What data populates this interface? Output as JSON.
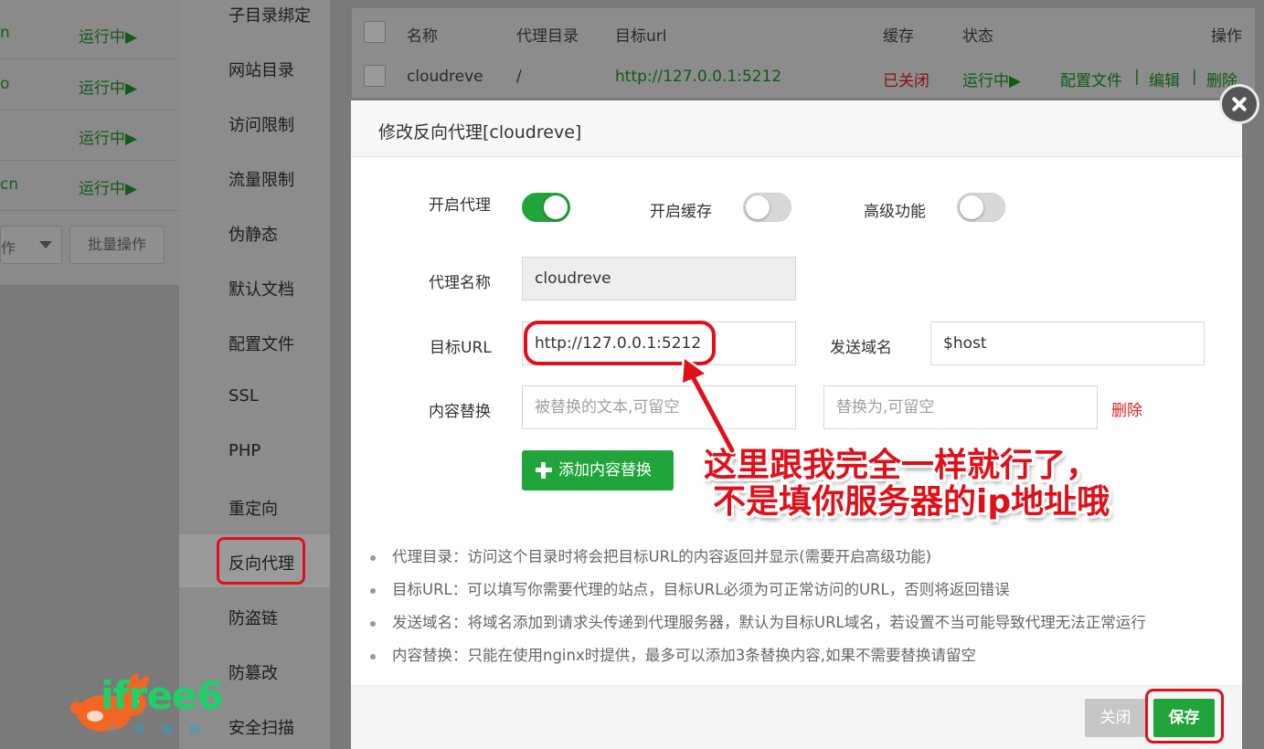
{
  "background_list": {
    "rows": [
      {
        "fragment": "n",
        "status": "运行中▶"
      },
      {
        "fragment": "o",
        "status": "运行中▶"
      },
      {
        "fragment": "",
        "status": "运行中▶"
      },
      {
        "fragment": "cn",
        "status": "运行中▶"
      }
    ],
    "select_label": "作",
    "batch_button": "批量操作"
  },
  "menu": {
    "items": [
      "子目录绑定",
      "网站目录",
      "访问限制",
      "流量限制",
      "伪静态",
      "默认文档",
      "配置文件",
      "SSL",
      "PHP",
      "重定向",
      "反向代理",
      "防盗链",
      "防篡改",
      "安全扫描"
    ],
    "active": "反向代理"
  },
  "proxy_table": {
    "headers": {
      "name": "名称",
      "dir": "代理目录",
      "url": "目标url",
      "cache": "缓存",
      "status": "状态",
      "ops": "操作"
    },
    "row": {
      "name": "cloudreve",
      "dir": "/",
      "url": "http://127.0.0.1:5212",
      "cache": "已关闭",
      "status": "运行中▶",
      "op_config": "配置文件",
      "sep1": "|",
      "op_edit": "编辑",
      "sep2": "|",
      "op_delete": "删除"
    }
  },
  "dialog": {
    "title": "修改反向代理[cloudreve]",
    "switches": {
      "proxy_label": "开启代理",
      "proxy_on": true,
      "cache_label": "开启缓存",
      "cache_on": false,
      "advanced_label": "高级功能",
      "advanced_on": false
    },
    "proxy_name_label": "代理名称",
    "proxy_name_value": "cloudreve",
    "target_url_label": "目标URL",
    "target_url_value": "http://127.0.0.1:5212",
    "send_domain_label": "发送域名",
    "send_domain_value": "$host",
    "content_replace_label": "内容替换",
    "replace_from_placeholder": "被替换的文本,可留空",
    "replace_to_placeholder": "替换为,可留空",
    "delete_label": "删除",
    "add_replace_button": "添加内容替换",
    "tips": [
      "代理目录：访问这个目录时将会把目标URL的内容返回并显示(需要开启高级功能)",
      "目标URL：可以填写你需要代理的站点，目标URL必须为可正常访问的URL，否则将返回错误",
      "发送域名：将域名添加到请求头传递到代理服务器，默认为目标URL域名，若设置不当可能导致代理无法正常运行",
      "内容替换：只能在使用nginx时提供，最多可以添加3条替换内容,如果不需要替换请留空"
    ],
    "close_button": "关闭",
    "save_button": "保存"
  },
  "annotation": {
    "line1": "这里跟我完全一样就行了，",
    "line2": "不是填你服务器的ip地址哦"
  },
  "logo": {
    "text": "ifree6",
    "sub": [
      "艾",
      "自",
      "由",
      "网"
    ]
  },
  "colors": {
    "accent_green": "#20a53a",
    "danger_red": "#e02020",
    "annotation_red": "#e0101a"
  }
}
